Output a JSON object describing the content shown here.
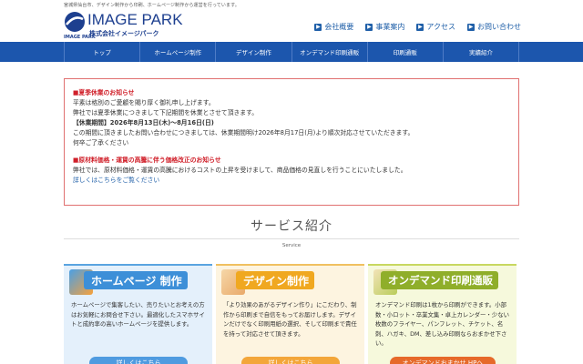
{
  "tagline": "宮城県仙台市、デザイン制作から印刷、ホームページ制作から運営を行っています。",
  "logo": {
    "title": "IMAGE PARK",
    "subtitle": "株式会社イメージパーク",
    "under_mark": "IMAGE PARK"
  },
  "top_links": [
    {
      "label": "会社概要"
    },
    {
      "label": "事業案内"
    },
    {
      "label": "アクセス"
    },
    {
      "label": "お問い合わせ"
    }
  ],
  "nav": [
    {
      "label": "トップ"
    },
    {
      "label": "ホームページ制作"
    },
    {
      "label": "デザイン制作"
    },
    {
      "label": "オンデマンド印刷通販"
    },
    {
      "label": "印刷通販"
    },
    {
      "label": "実績紹介"
    }
  ],
  "notice": {
    "summer": {
      "heading": "■夏季休業のお知らせ",
      "line1": "平素は格別のご愛顧を賜り厚く御礼申し上げます。",
      "line2": "弊社では夏季休業につきまして下記期間を休業とさせて頂きます。",
      "period": "【休業期間】2026年8月13日(木)～8月16日(日)",
      "line3": "この期間に頂きましたお問い合わせにつきましては、休業期間明け2026年8月17日(月)より順次対応させていただきます。",
      "line4": "何卒ご了承ください"
    },
    "price": {
      "heading": "■原材料価格・運賃の高騰に伴う価格改正のお知らせ",
      "line1": "弊社では、原材料価格・運賃の高騰におけるコストの上昇を受けまして、商品価格の見直しを行うことにいたしました。",
      "link": "詳しくはこちらをご覧ください"
    }
  },
  "services": {
    "title": "サービス紹介",
    "subtitle": "Service",
    "cards": [
      {
        "title": "ホームページ 制作",
        "text": "ホームページで集客したい、売りたいとお考えの方はお気軽にお問合せ下さい。最適化したスマホサイトと成約率の高いホームページを提供します。",
        "button": "詳しくはこちら"
      },
      {
        "title": "デザイン制作",
        "text": "「より効果のあがるデザイン作り」にこだわり、制作から印刷まで自信をもってお届けします。デザインだけでなく印刷用紙の選択、そして印刷まで責任を持って対応させて頂きます。",
        "button": "詳しくはこちら"
      },
      {
        "title": "オンデマンド印刷通販",
        "text": "オンデマンド印刷は1枚から印刷ができます。小部数・小ロット・卒業文集・卓上カレンダー・少ない枚数のフライヤー、パンフレット、チケット、名刺、ハガキ、DM、差し込み印刷ならおまかせ下さい。",
        "button": "オンデマンドおまかせ HPへ"
      }
    ]
  },
  "colors": {
    "nav_bg": "#1c56ad",
    "brand_blue": "#1d3f8f",
    "notice_border": "#e07070",
    "notice_heading": "#d0202a"
  }
}
